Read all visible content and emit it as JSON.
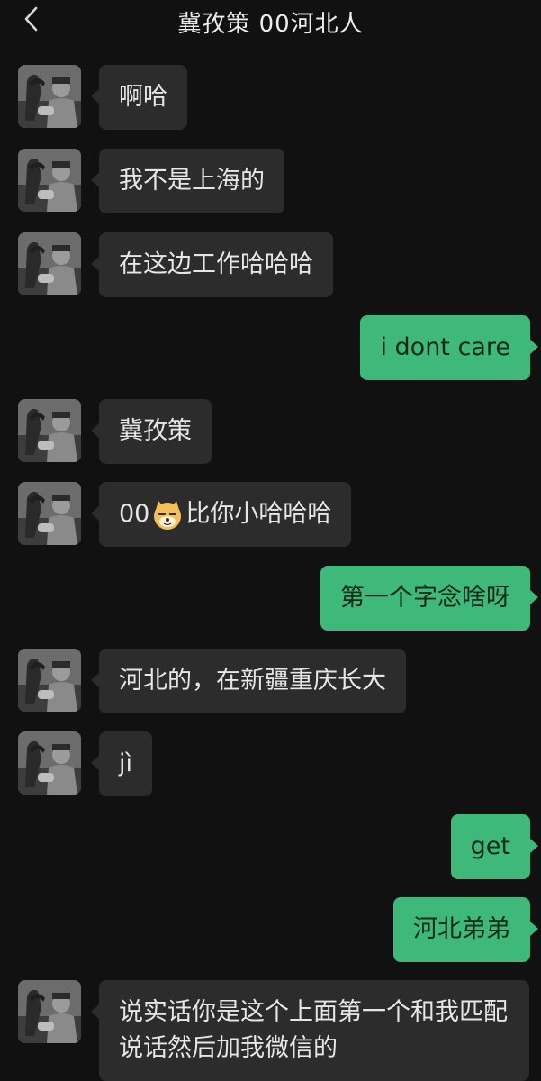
{
  "header": {
    "title": "冀孜策 00河北人",
    "back_icon": "chevron-left-icon"
  },
  "colors": {
    "background": "#111111",
    "incoming_bubble": "#2c2c2c",
    "outgoing_bubble": "#3fb97a"
  },
  "messages": [
    {
      "side": "left",
      "text": "啊哈"
    },
    {
      "side": "left",
      "text": "我不是上海的"
    },
    {
      "side": "left",
      "text": "在这边工作哈哈哈"
    },
    {
      "side": "right",
      "text": "i dont care"
    },
    {
      "side": "left",
      "text": "冀孜策"
    },
    {
      "side": "left",
      "text_before": "00",
      "emoji": "doge-emoji",
      "text_after": "比你小哈哈哈"
    },
    {
      "side": "right",
      "text": "第一个字念啥呀"
    },
    {
      "side": "left",
      "text": "河北的，在新疆重庆长大"
    },
    {
      "side": "left",
      "text": "jì"
    },
    {
      "side": "right",
      "text": "get"
    },
    {
      "side": "right",
      "text": "河北弟弟"
    },
    {
      "side": "left",
      "text": "说实话你是这个上面第一个和我匹配说话然后加我微信的"
    }
  ]
}
